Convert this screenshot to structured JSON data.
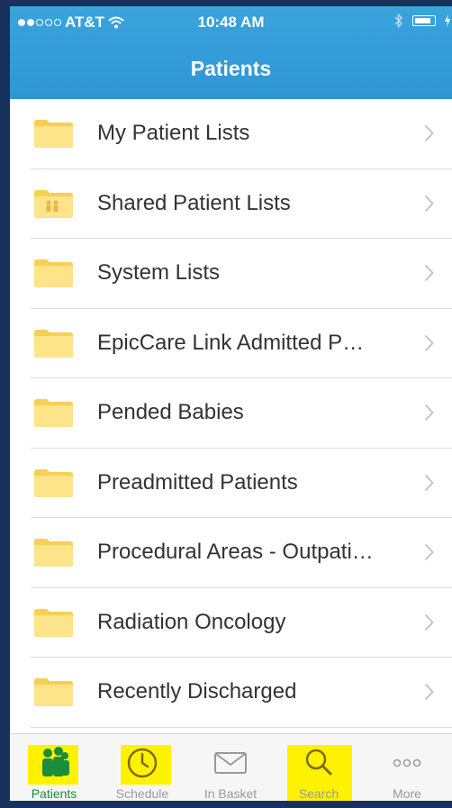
{
  "status_bar": {
    "carrier": "AT&T",
    "time": "10:48 AM"
  },
  "nav": {
    "title": "Patients"
  },
  "list": {
    "items": [
      {
        "label": "My Patient Lists",
        "icon": "folder-icon"
      },
      {
        "label": "Shared Patient Lists",
        "icon": "shared-folder-icon"
      },
      {
        "label": "System Lists",
        "icon": "folder-icon"
      },
      {
        "label": "EpicCare Link Admitted P…",
        "icon": "folder-icon"
      },
      {
        "label": "Pended Babies",
        "icon": "folder-icon"
      },
      {
        "label": "Preadmitted Patients",
        "icon": "folder-icon"
      },
      {
        "label": "Procedural Areas - Outpati…",
        "icon": "folder-icon"
      },
      {
        "label": "Radiation Oncology",
        "icon": "folder-icon"
      },
      {
        "label": "Recently Discharged",
        "icon": "folder-icon"
      }
    ]
  },
  "tabbar": {
    "tabs": [
      {
        "label": "Patients",
        "icon": "patients-icon"
      },
      {
        "label": "Schedule",
        "icon": "clock-icon"
      },
      {
        "label": "In Basket",
        "icon": "envelope-icon"
      },
      {
        "label": "Search",
        "icon": "search-icon"
      },
      {
        "label": "More",
        "icon": "more-dots-icon"
      }
    ]
  },
  "colors": {
    "nav_blue": "#3aa4dd",
    "folder_yellow": "#fde38a",
    "highlight_yellow": "#fff200",
    "active_tab_green": "#1a8e3a"
  }
}
